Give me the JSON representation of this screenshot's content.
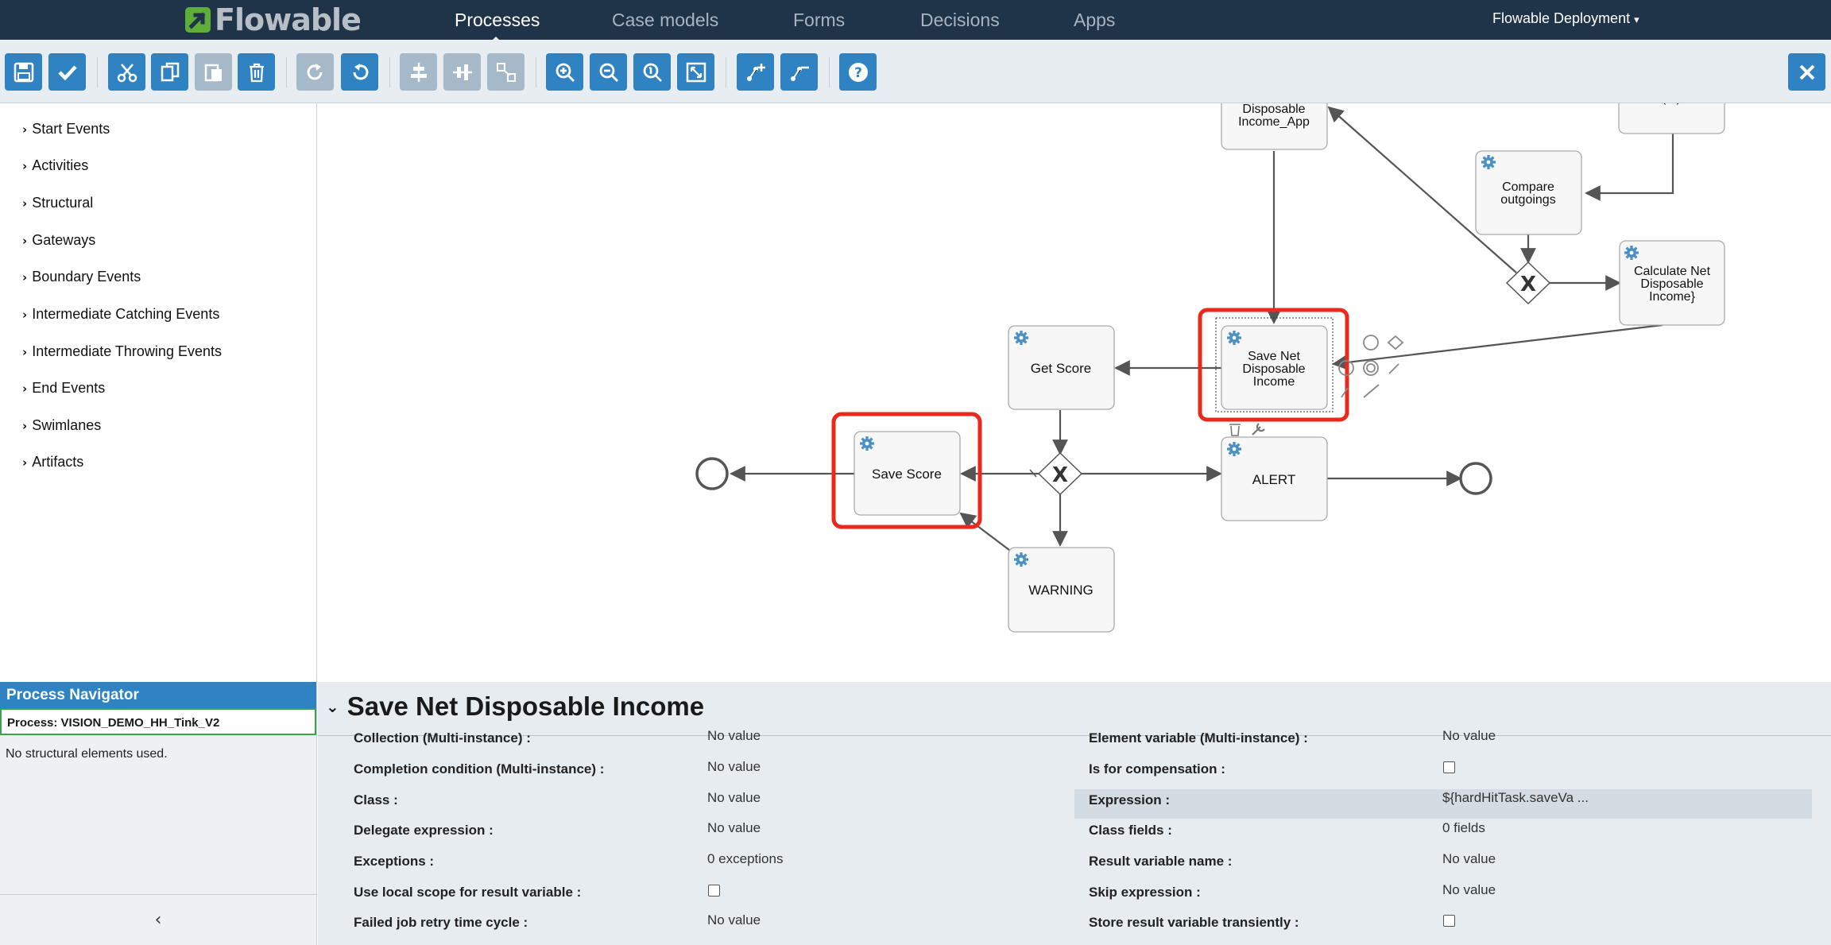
{
  "app": {
    "logo_text": "Flowable"
  },
  "nav": {
    "items": [
      "Processes",
      "Case models",
      "Forms",
      "Decisions",
      "Apps"
    ],
    "active": "Processes",
    "deployment": "Flowable Deployment"
  },
  "toolbar": {
    "buttons": [
      "save",
      "validate",
      "cut",
      "copy",
      "paste",
      "delete",
      "redo",
      "undo",
      "align-horizontal",
      "align-vertical",
      "same-size",
      "zoom-in",
      "zoom-out",
      "zoom-actual",
      "zoom-fit",
      "add-bendpoint",
      "remove-bendpoint",
      "help",
      "close"
    ]
  },
  "palette": {
    "items": [
      "Start Events",
      "Activities",
      "Structural",
      "Gateways",
      "Boundary Events",
      "Intermediate Catching Events",
      "Intermediate Throwing Events",
      "End Events",
      "Swimlanes",
      "Artifacts"
    ]
  },
  "diagram": {
    "tasks": {
      "disposable_app": "Disposable\nIncome_App",
      "compare": "Compare\noutgoings",
      "calc_net": "Calculate Net\nDisposable\nIncome}",
      "get_score": "Get Score",
      "save_net": "Save Net\nDisposable\nIncome",
      "save_score": "Save Score",
      "alert": "ALERT",
      "warning": "WARNING",
      "partial_top": "(...)"
    },
    "gateway_symbol": "X",
    "highlight_color": "#e8291c"
  },
  "navigator": {
    "title": "Process Navigator",
    "process": "Process: VISION_DEMO_HH_Tink_V2",
    "empty": "No structural elements used.",
    "collapse_icon": "‹"
  },
  "properties": {
    "title": "Save Net Disposable Income",
    "left": [
      {
        "label": "Collection (Multi-instance) :",
        "value": "No value"
      },
      {
        "label": "Completion condition (Multi-instance) :",
        "value": "No value"
      },
      {
        "label": "Class :",
        "value": "No value"
      },
      {
        "label": "Delegate expression :",
        "value": "No value"
      },
      {
        "label": "Exceptions :",
        "value": "0 exceptions"
      },
      {
        "label": "Use local scope for result variable :",
        "value": ""
      },
      {
        "label": "Failed job retry time cycle :",
        "value": "No value"
      }
    ],
    "right": [
      {
        "label": "Element variable (Multi-instance) :",
        "value": "No value"
      },
      {
        "label": "Is for compensation :",
        "value": ""
      },
      {
        "label": "Expression :",
        "value": "${hardHitTask.saveVa ..."
      },
      {
        "label": "Class fields :",
        "value": "0 fields"
      },
      {
        "label": "Result variable name :",
        "value": "No value"
      },
      {
        "label": "Skip expression :",
        "value": "No value"
      },
      {
        "label": "Store result variable transiently :",
        "value": ""
      }
    ]
  }
}
